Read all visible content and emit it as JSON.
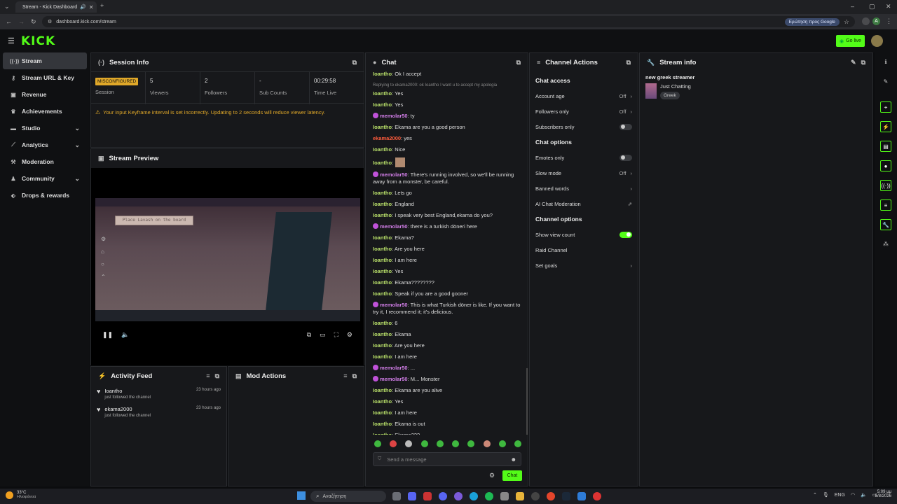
{
  "browser": {
    "tab_title": "Stream - Kick Dashboard",
    "url": "dashboard.kick.com/stream",
    "google_pill": "Ερώτηση προς Google",
    "profile_initial": "A"
  },
  "app": {
    "logo": "KICK",
    "go_live": "Go live"
  },
  "sidebar": {
    "items": [
      {
        "label": "Stream",
        "icon": "signal-icon"
      },
      {
        "label": "Stream URL & Key",
        "icon": "key-icon"
      },
      {
        "label": "Revenue",
        "icon": "revenue-icon"
      },
      {
        "label": "Achievements",
        "icon": "trophy-icon"
      },
      {
        "label": "Studio",
        "icon": "studio-icon"
      },
      {
        "label": "Analytics",
        "icon": "analytics-icon"
      },
      {
        "label": "Moderation",
        "icon": "hammer-icon"
      },
      {
        "label": "Community",
        "icon": "community-icon"
      },
      {
        "label": "Drops & rewards",
        "icon": "gift-icon"
      }
    ]
  },
  "session": {
    "title": "Session Info",
    "status_badge": "MISCONFIGURED",
    "status_label": "Session",
    "viewers_value": "5",
    "viewers_label": "Viewers",
    "followers_value": "2",
    "followers_label": "Followers",
    "subs_value": "-",
    "subs_label": "Sub Counts",
    "time_value": "00:29:58",
    "time_label": "Time Live",
    "warning": "Your input Keyframe interval is set incorrectly. Updating to 2 seconds will reduce viewer latency."
  },
  "preview": {
    "title": "Stream Preview",
    "game_prompt": "Place Lavash on the board"
  },
  "activity": {
    "title": "Activity Feed",
    "items": [
      {
        "user": "Ioantho",
        "action": "just followed the channel",
        "time": "23 hours ago"
      },
      {
        "user": "ekama2000",
        "action": "just followed the channel",
        "time": "23 hours ago"
      }
    ]
  },
  "mod_actions": {
    "title": "Mod Actions"
  },
  "chat": {
    "title": "Chat",
    "reply_note": "Replying to ekama2000: ok Ioantho I want u to accept my apologia",
    "messages": [
      {
        "user": "Ioantho",
        "text": ": Ok I accept",
        "kind": "i"
      },
      {
        "user": "Ioantho",
        "text": ": Yes",
        "kind": "i"
      },
      {
        "user": "Ioantho",
        "text": ": Yes",
        "kind": "i"
      },
      {
        "user": "memolar50",
        "text": ": ty",
        "kind": "m"
      },
      {
        "user": "Ioantho",
        "text": ": Ekama are you a good person",
        "kind": "i"
      },
      {
        "user": "ekama2000",
        "text": ": yes",
        "kind": "e"
      },
      {
        "user": "Ioantho",
        "text": ": Nice",
        "kind": "i"
      },
      {
        "user": "Ioantho",
        "text": ":",
        "kind": "i"
      },
      {
        "user": "memolar50",
        "text": ": There's running involved, so we'll be running away from a monster, be careful.",
        "kind": "m"
      },
      {
        "user": "Ioantho",
        "text": ": Lets go",
        "kind": "i"
      },
      {
        "user": "Ioantho",
        "text": ": England",
        "kind": "i"
      },
      {
        "user": "Ioantho",
        "text": ": I speak very best England,ekama do you?",
        "kind": "i"
      },
      {
        "user": "memolar50",
        "text": ": there is a turkish döneri here",
        "kind": "m"
      },
      {
        "user": "Ioantho",
        "text": ": Ekama?",
        "kind": "i"
      },
      {
        "user": "Ioantho",
        "text": ": Are you here",
        "kind": "i"
      },
      {
        "user": "Ioantho",
        "text": ": I am here",
        "kind": "i"
      },
      {
        "user": "Ioantho",
        "text": ": Yes",
        "kind": "i"
      },
      {
        "user": "Ioantho",
        "text": ": Ekama????????",
        "kind": "i"
      },
      {
        "user": "Ioantho",
        "text": ": Speak if you are a good gooner",
        "kind": "i"
      },
      {
        "user": "memolar50",
        "text": ": This is what Turkish döner is like. If you want to try it, I recommend it; it's delicious.",
        "kind": "m"
      },
      {
        "user": "Ioantho",
        "text": ": 6",
        "kind": "i"
      },
      {
        "user": "Ioantho",
        "text": ": Ekama",
        "kind": "i"
      },
      {
        "user": "Ioantho",
        "text": ": Are you here",
        "kind": "i"
      },
      {
        "user": "Ioantho",
        "text": ": I am here",
        "kind": "i"
      },
      {
        "user": "memolar50",
        "text": ": ...",
        "kind": "m"
      },
      {
        "user": "memolar50",
        "text": ": M... Monster",
        "kind": "m"
      },
      {
        "user": "Ioantho",
        "text": ": Ekama are you alive",
        "kind": "i"
      },
      {
        "user": "Ioantho",
        "text": ": Yes",
        "kind": "i"
      },
      {
        "user": "Ioantho",
        "text": ": I am here",
        "kind": "i"
      },
      {
        "user": "Ioantho",
        "text": ": Ekama is out",
        "kind": "i"
      },
      {
        "user": "Ioantho",
        "text": ": Ekama???",
        "kind": "i"
      }
    ],
    "input_placeholder": "Send a message",
    "send_label": "Chat"
  },
  "channel_actions": {
    "title": "Channel Actions",
    "chat_access": "Chat access",
    "account_age": "Account age",
    "account_age_value": "Off",
    "followers_only": "Followers only",
    "followers_only_value": "Off",
    "subscribers_only": "Subscribers only",
    "chat_options": "Chat options",
    "emotes_only": "Emotes only",
    "slow_mode": "Slow mode",
    "slow_mode_value": "Off",
    "banned_words": "Banned words",
    "ai_moderation": "AI Chat Moderation",
    "channel_options": "Channel options",
    "show_view_count": "Show view count",
    "raid_channel": "Raid Channel",
    "set_goals": "Set goals"
  },
  "stream_info": {
    "title": "Stream info",
    "stream_title": "new greek streamer",
    "category": "Just Chatting",
    "tag": "Greek"
  },
  "taskbar": {
    "weather_temp": "33°C",
    "weather_desc": "Ηλιοφάνεια",
    "search": "Αναζήτηση",
    "lang": "ENG",
    "time": "5:09 μμ",
    "date": "5/8/2026"
  },
  "colors": {
    "brand": "#53fc18",
    "warning": "#e0a829"
  }
}
